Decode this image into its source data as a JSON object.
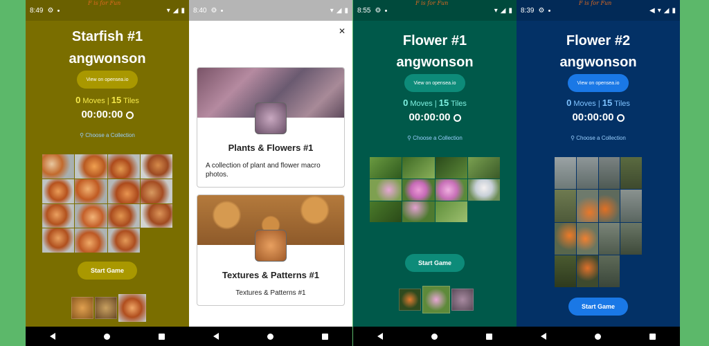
{
  "screens": [
    {
      "status": {
        "time": "8:49"
      },
      "brand": "F is for Fun",
      "title": "Starfish #1",
      "artist": "angwonson",
      "opensea": "View on opensea.io",
      "moves": "0",
      "moves_label": "Moves |",
      "tiles": "15",
      "tiles_label": "Tiles",
      "timer": "00:00:00",
      "collection": "Choose a Collection",
      "start": "Start Game",
      "colors": {
        "bg": "#7a6e00",
        "button": "#a99800",
        "accent": "#f6e94a"
      }
    },
    {
      "status": {
        "time": "8:40"
      },
      "cards": [
        {
          "title": "Plants & Flowers #1",
          "desc": "A collection of plant and flower macro photos."
        },
        {
          "title": "Textures & Patterns #1",
          "desc": "Textures & Patterns #1"
        }
      ]
    },
    {
      "status": {
        "time": "8:55"
      },
      "brand": "F is for Fun",
      "title": "Flower #1",
      "artist": "angwonson",
      "opensea": "View on opensea.io",
      "moves": "0",
      "moves_label": "Moves |",
      "tiles": "15",
      "tiles_label": "Tiles",
      "timer": "00:00:00",
      "collection": "Choose a Collection",
      "start": "Start Game",
      "colors": {
        "bg": "#00594a",
        "button": "#0d8b79",
        "accent": "#7ef0e0"
      }
    },
    {
      "status": {
        "time": "8:39"
      },
      "brand": "F is for Fun",
      "title": "Flower #2",
      "artist": "angwonson",
      "opensea": "View on opensea.io",
      "moves": "0",
      "moves_label": "Moves |",
      "tiles": "15",
      "tiles_label": "Tiles",
      "timer": "00:00:00",
      "collection": "Choose a Collection",
      "start": "Start Game",
      "colors": {
        "bg": "#033166",
        "button": "#1a78e6",
        "accent": "#7ec2ff"
      }
    }
  ]
}
